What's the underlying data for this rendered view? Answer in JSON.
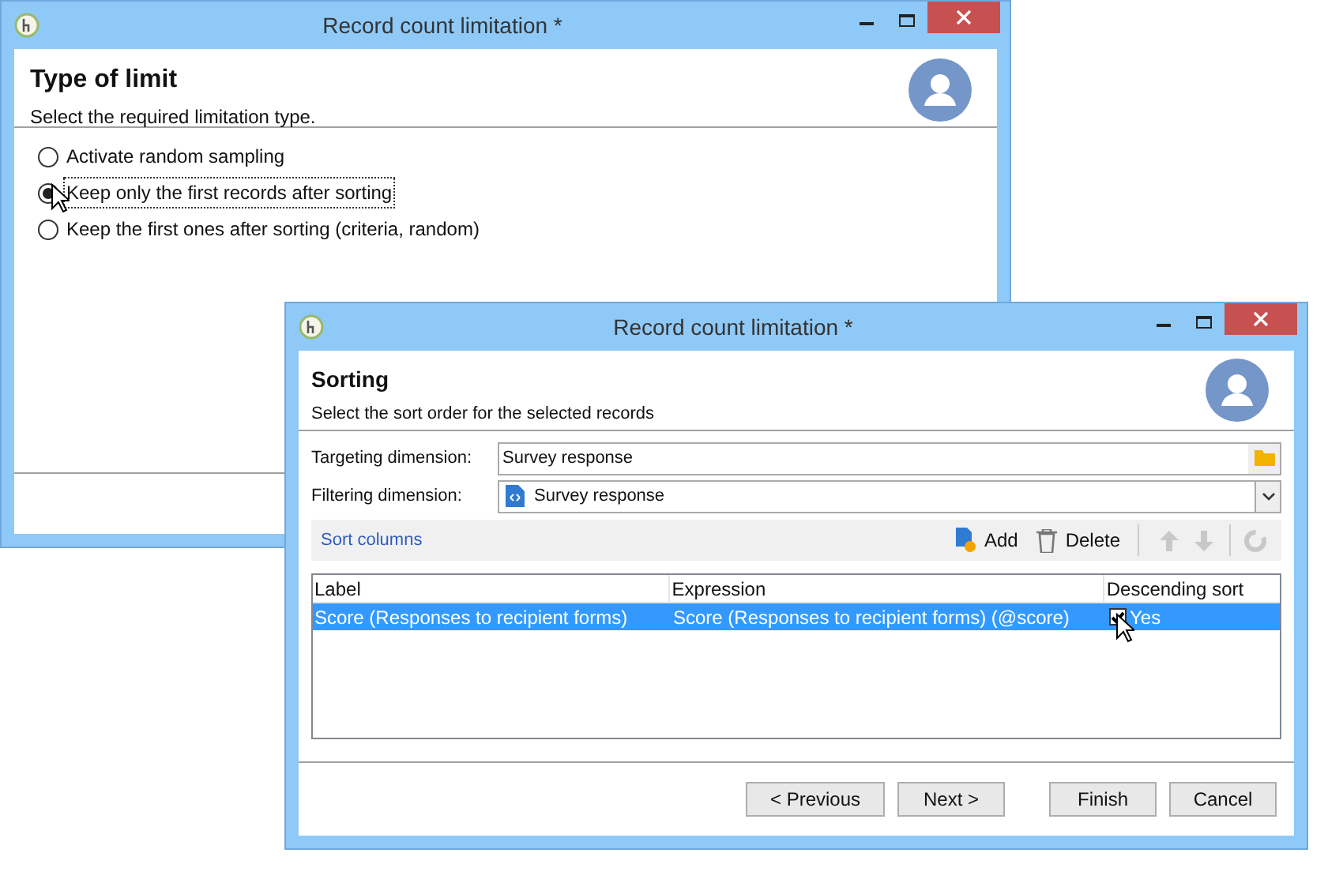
{
  "back_window": {
    "title": "Record count limitation *",
    "header": {
      "title": "Type of limit",
      "subtitle": "Select the required limitation type."
    },
    "options": [
      {
        "label": "Activate random sampling",
        "selected": false,
        "focused": false
      },
      {
        "label": "Keep only the first records after sorting",
        "selected": true,
        "focused": true
      },
      {
        "label": "Keep the first ones after sorting (criteria, random)",
        "selected": false,
        "focused": false
      }
    ]
  },
  "front_window": {
    "title": "Record count limitation *",
    "header": {
      "title": "Sorting",
      "subtitle": "Select the sort order for the selected records"
    },
    "fields": [
      {
        "kind": "browse",
        "label": "Targeting dimension:",
        "value": "Survey response"
      },
      {
        "kind": "dropdown",
        "label": "Filtering dimension:",
        "value": "Survey response"
      }
    ],
    "toolbar": {
      "title": "Sort columns",
      "add": "Add",
      "delete": "Delete",
      "move_up": {
        "disabled": true
      },
      "move_down": {
        "disabled": true
      },
      "reset": {
        "disabled": true
      }
    },
    "table": {
      "columns": [
        "Label",
        "Expression",
        "Descending sort"
      ],
      "rows": [
        {
          "selected": true,
          "label": "Score (Responses to recipient forms)",
          "expression": "Score (Responses to recipient forms) (@score)",
          "descending": {
            "checked": true,
            "text": "Yes"
          }
        }
      ]
    },
    "buttons": [
      "< Previous",
      "Next >",
      "Finish",
      "Cancel"
    ]
  }
}
